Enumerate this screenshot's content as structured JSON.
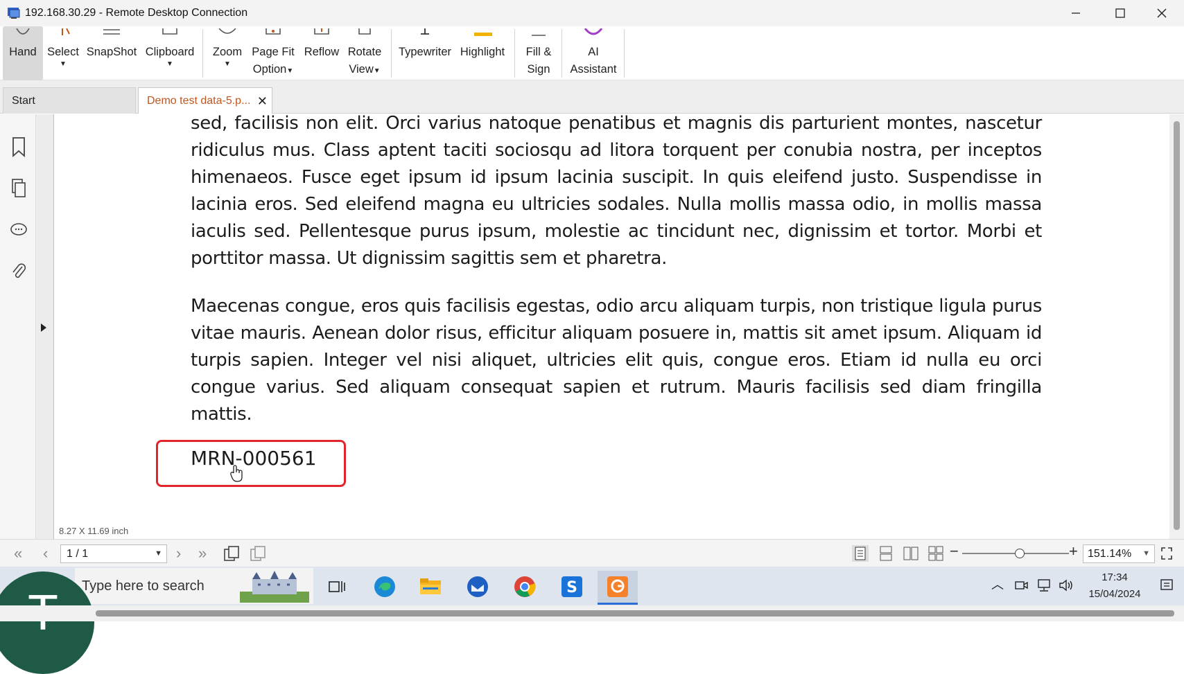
{
  "window": {
    "title": "192.168.30.29 - Remote Desktop Connection",
    "minimize_icon": "minimize-icon",
    "maximize_icon": "maximize-icon",
    "close_icon": "close-icon"
  },
  "ribbon": {
    "buttons": [
      {
        "label": "Hand",
        "icon": "hand-icon"
      },
      {
        "label": "Select",
        "icon": "select-cursor-icon"
      },
      {
        "label": "SnapShot",
        "icon": "snapshot-icon"
      },
      {
        "label": "Clipboard",
        "icon": "clipboard-icon"
      },
      {
        "label": "Zoom",
        "icon": "zoom-icon"
      },
      {
        "label": "Page Fit",
        "label2": "Option",
        "icon": "page-fit-icon"
      },
      {
        "label": "Reflow",
        "icon": "reflow-icon"
      },
      {
        "label": "Rotate",
        "label2": "View",
        "icon": "rotate-view-icon"
      },
      {
        "label": "Typewriter",
        "icon": "typewriter-icon"
      },
      {
        "label": "Highlight",
        "icon": "highlight-icon"
      },
      {
        "label": "Fill &",
        "label2": "Sign",
        "icon": "fill-sign-icon"
      },
      {
        "label": "AI",
        "label2": "Assistant",
        "icon": "ai-assistant-icon"
      }
    ],
    "highlight_color": "#f0b400",
    "ai_color": "#a03ec8"
  },
  "tabs": [
    {
      "label": "Start",
      "active": false
    },
    {
      "label": "Demo test data-5.p...",
      "active": true
    }
  ],
  "sidebar": {
    "icons": [
      "bookmark-icon",
      "pages-icon",
      "comments-icon",
      "attachment-icon"
    ],
    "expand_icon": "expand-panel-icon"
  },
  "document": {
    "paragraph1": "sed, facilisis non elit. Orci varius natoque penatibus et magnis dis parturient montes, nascetur ridiculus mus. Class aptent taciti sociosqu ad litora torquent per conubia nostra, per inceptos himenaeos. Fusce eget ipsum id ipsum lacinia suscipit. In quis eleifend justo. Suspendisse in lacinia eros. Sed eleifend magna eu ultricies sodales. Nulla mollis massa odio, in mollis massa iaculis sed. Pellentesque purus ipsum, molestie ac tincidunt nec, dignissim et tortor. Morbi et porttitor massa. Ut dignissim sagittis sem et pharetra.",
    "paragraph2": "Maecenas congue, eros quis facilisis egestas, odio arcu aliquam turpis, non tristique ligula purus vitae mauris. Aenean dolor risus, efficitur aliquam posuere in, mattis sit amet ipsum. Aliquam id turpis sapien. Integer vel nisi aliquet, ultricies elit quis, congue eros. Etiam id nulla eu orci congue varius. Sed aliquam consequat sapien et rutrum. Mauris facilisis sed diam fringilla mattis.",
    "mrn": "MRN-000561",
    "highlight_box_color": "#e2252b",
    "page_size": "8.27 X 11.69 inch"
  },
  "navbar": {
    "page_value": "1 / 1",
    "zoom_value": "151.14%",
    "zoom_level_fraction": 0.54
  },
  "taskbar": {
    "search_placeholder": "Type here to search",
    "avatar_letter": "T",
    "apps": [
      "task-view-icon",
      "edge-icon",
      "file-explorer-icon",
      "thunderbird-icon",
      "chrome-icon",
      "s-app-icon",
      "foxit-pdf-icon"
    ],
    "time": "17:34",
    "date": "15/04/2024"
  }
}
